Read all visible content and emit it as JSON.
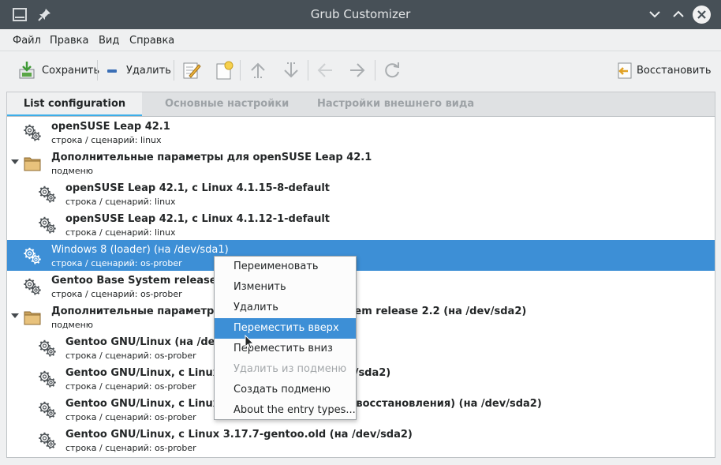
{
  "window": {
    "title": "Grub Customizer"
  },
  "menubar": {
    "items": [
      "Файл",
      "Правка",
      "Вид",
      "Справка"
    ]
  },
  "toolbar": {
    "save_label": "Сохранить",
    "delete_label": "Удалить",
    "restore_label": "Восстановить"
  },
  "tabs": [
    {
      "label": "List configuration",
      "active": true
    },
    {
      "label": "Основные настройки",
      "active": false
    },
    {
      "label": "Настройки внешнего вида",
      "active": false
    }
  ],
  "entries": [
    {
      "title": "openSUSE Leap 42.1",
      "subtitle": "строка / сценарий: linux",
      "kind": "entry",
      "level": 0,
      "selected": false
    },
    {
      "title": "Дополнительные параметры для openSUSE Leap 42.1",
      "subtitle": "подменю",
      "kind": "submenu",
      "level": 0,
      "selected": false
    },
    {
      "title": "openSUSE Leap 42.1, с Linux 4.1.15-8-default",
      "subtitle": "строка / сценарий: linux",
      "kind": "entry",
      "level": 1,
      "selected": false
    },
    {
      "title": "openSUSE Leap 42.1, с Linux 4.1.12-1-default",
      "subtitle": "строка / сценарий: linux",
      "kind": "entry",
      "level": 1,
      "selected": false
    },
    {
      "title": "Windows 8 (loader) (на /dev/sda1)",
      "subtitle": "строка / сценарий: os-prober",
      "kind": "entry",
      "level": 0,
      "selected": true
    },
    {
      "title": "Gentoo Base System release 2.2",
      "subtitle": "строка / сценарий: os-prober",
      "kind": "entry",
      "level": 0,
      "selected": false
    },
    {
      "title": "Дополнительные параметры для Gentoo Base System release 2.2 (на /dev/sda2)",
      "subtitle": "подменю",
      "kind": "submenu",
      "level": 0,
      "selected": false
    },
    {
      "title": "Gentoo GNU/Linux (на /dev/sda2)",
      "subtitle": "строка / сценарий: os-prober",
      "kind": "entry",
      "level": 1,
      "selected": false
    },
    {
      "title": "Gentoo GNU/Linux, с Linux 3.17.7-gentoo (на /dev/sda2)",
      "subtitle": "строка / сценарий: os-prober",
      "kind": "entry",
      "level": 1,
      "selected": false
    },
    {
      "title": "Gentoo GNU/Linux, с Linux 3.17.7-gentoo (режим восстановления) (на /dev/sda2)",
      "subtitle": "строка / сценарий: os-prober",
      "kind": "entry",
      "level": 1,
      "selected": false
    },
    {
      "title": "Gentoo GNU/Linux, с Linux 3.17.7-gentoo.old (на /dev/sda2)",
      "subtitle": "строка / сценарий: os-prober",
      "kind": "entry",
      "level": 1,
      "selected": false
    }
  ],
  "context_menu": {
    "items": [
      {
        "label": "Переименовать",
        "state": "normal"
      },
      {
        "label": "Изменить",
        "state": "normal"
      },
      {
        "label": "Удалить",
        "state": "normal"
      },
      {
        "label": "Переместить вверх",
        "state": "highlighted"
      },
      {
        "label": "Переместить вниз",
        "state": "normal"
      },
      {
        "label": "Удалить из подменю",
        "state": "disabled"
      },
      {
        "label": "Создать подменю",
        "state": "normal"
      },
      {
        "label": "About the entry types...",
        "state": "normal"
      }
    ]
  },
  "colors": {
    "accent": "#3d8fd6",
    "titlebar": "#475057",
    "tab_indicator": "#3daee9"
  },
  "icons": [
    "window-menu-icon",
    "pin-icon",
    "minimize-icon",
    "maximize-icon",
    "close-icon",
    "save-icon",
    "delete-icon",
    "edit-icon",
    "new-icon",
    "move-up-icon",
    "move-down-icon",
    "move-left-icon",
    "move-right-icon",
    "refresh-icon",
    "restore-icon",
    "gear-icon",
    "folder-icon",
    "expander-icon",
    "mouse-cursor-icon"
  ]
}
